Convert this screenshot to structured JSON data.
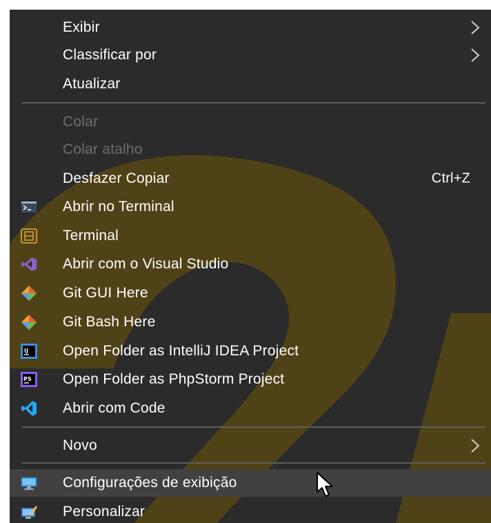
{
  "context_menu": {
    "view": {
      "label": "Exibir"
    },
    "sort_by": {
      "label": "Classificar por"
    },
    "refresh": {
      "label": "Atualizar"
    },
    "paste": {
      "label": "Colar"
    },
    "paste_shortcut": {
      "label": "Colar atalho"
    },
    "undo_copy": {
      "label": "Desfazer Copiar",
      "shortcut": "Ctrl+Z"
    },
    "open_terminal": {
      "label": "Abrir no Terminal",
      "icon": "terminal-prompt-icon"
    },
    "terminal": {
      "label": "Terminal",
      "icon": "terminal-app-icon"
    },
    "open_visual_studio": {
      "label": "Abrir com o Visual Studio",
      "icon": "visual-studio-icon"
    },
    "git_gui": {
      "label": "Git GUI Here",
      "icon": "git-icon"
    },
    "git_bash": {
      "label": "Git Bash Here",
      "icon": "git-icon"
    },
    "open_intellij": {
      "label": "Open Folder as IntelliJ IDEA Project",
      "icon": "intellij-icon"
    },
    "open_phpstorm": {
      "label": "Open Folder as PhpStorm Project",
      "icon": "phpstorm-icon"
    },
    "open_code": {
      "label": "Abrir com Code",
      "icon": "vscode-icon"
    },
    "new": {
      "label": "Novo"
    },
    "display_settings": {
      "label": "Configurações de exibição",
      "icon": "display-icon"
    },
    "personalize": {
      "label": "Personalizar",
      "icon": "personalize-icon"
    }
  },
  "colors": {
    "menu_background": "#2b2b2b",
    "hover_background": "#414141",
    "text": "#ffffff",
    "disabled_text": "#6d6d6d",
    "separator": "#5d5d5d",
    "watermark": "#6b5510"
  }
}
